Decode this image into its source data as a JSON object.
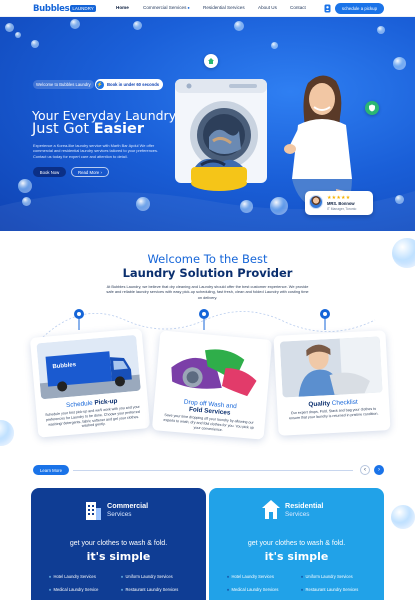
{
  "nav": {
    "logo_main": "Bubbles",
    "logo_sub": "LAUNDRY",
    "items": [
      {
        "label": "Home"
      },
      {
        "label": "Commercial Services"
      },
      {
        "label": "Residential Services"
      },
      {
        "label": "About Us"
      },
      {
        "label": "Contact"
      }
    ],
    "cta": "schedule a pickup"
  },
  "hero": {
    "welcome_pill": "Welcome to Bubbles Laundry",
    "book_pill": "Book in under 60 seconds",
    "title_line1": "Your Everyday Laundry",
    "title_line2_prefix": "Just Got ",
    "title_line2_bold": "Easier",
    "description": "Experience a Korea-like laundry service with Marth Bar Apdul We offer commercial and residential laundry services tailored to your preferences. Contact us today for expert care and attention to detail.",
    "btn_book": "Book Now",
    "btn_more": "Read More ›",
    "review": {
      "stars": "★★★★★",
      "name": "MRS. Bonnow",
      "role": "IT Manager, Toronto"
    }
  },
  "welcome": {
    "heading_light": "Welcome To the Best",
    "heading_bold": "Laundry Solution Provider",
    "paragraph": "At Bubbles Laundry, we believe that dry cleaning and Laundry should offer the best customer experience. We provide safe and reliable laundry services with easy pick-up scheduling, fast fresh, clean and folded Laundry with costing time on delivery."
  },
  "cards": [
    {
      "title_light": "Schedule ",
      "title_bold": "Pick-up",
      "text": "Schedule your first pick-up and we'll work with you and your preferences for Laundry to be done. Choose your preferred washing/ detergents, fabric softener and get your clothes washed gently."
    },
    {
      "title_light": "Drop off Wash and",
      "title_bold": "Fold Services",
      "text": "Save your time dropping off your laundry by allowing our experts to wash, dry and fold clothes for you. You pick up your convenience."
    },
    {
      "title_light": "",
      "title_bold": "Quality",
      "title_light2": " Checklist",
      "text": "Our expert drops, Fold, Stack and bag your clothes to ensure that your laundry is returned in pristine condition."
    }
  ],
  "learn_more": "Learn More",
  "panels": [
    {
      "title": "Commercial",
      "subtitle": "Services",
      "tagline": "get your clothes to wash & fold.",
      "tagline_bold": "it's simple",
      "items": [
        "Hotel Laundry Services",
        "Uniform Laundry Services",
        "Medical Laundry Service",
        "Restaurant Laundry Services"
      ]
    },
    {
      "title": "Residential",
      "subtitle": "Services",
      "tagline": "get your clothes to wash & fold.",
      "tagline_bold": "it's simple",
      "items": [
        "Hotel Laundry Services",
        "Uniform Laundry Services",
        "Medical Laundry Services",
        "Restaurant Laundry Services"
      ]
    }
  ],
  "colors": {
    "brand_blue": "#1565d8",
    "cta_blue": "#1a73e8",
    "navy": "#0f3d94",
    "sky": "#21a2e8"
  },
  "icons": [
    "user-icon",
    "chevron-right-icon",
    "chevron-left-icon",
    "location-pin-icon",
    "building-icon",
    "house-icon",
    "hanger-icon",
    "shirt-icon"
  ]
}
